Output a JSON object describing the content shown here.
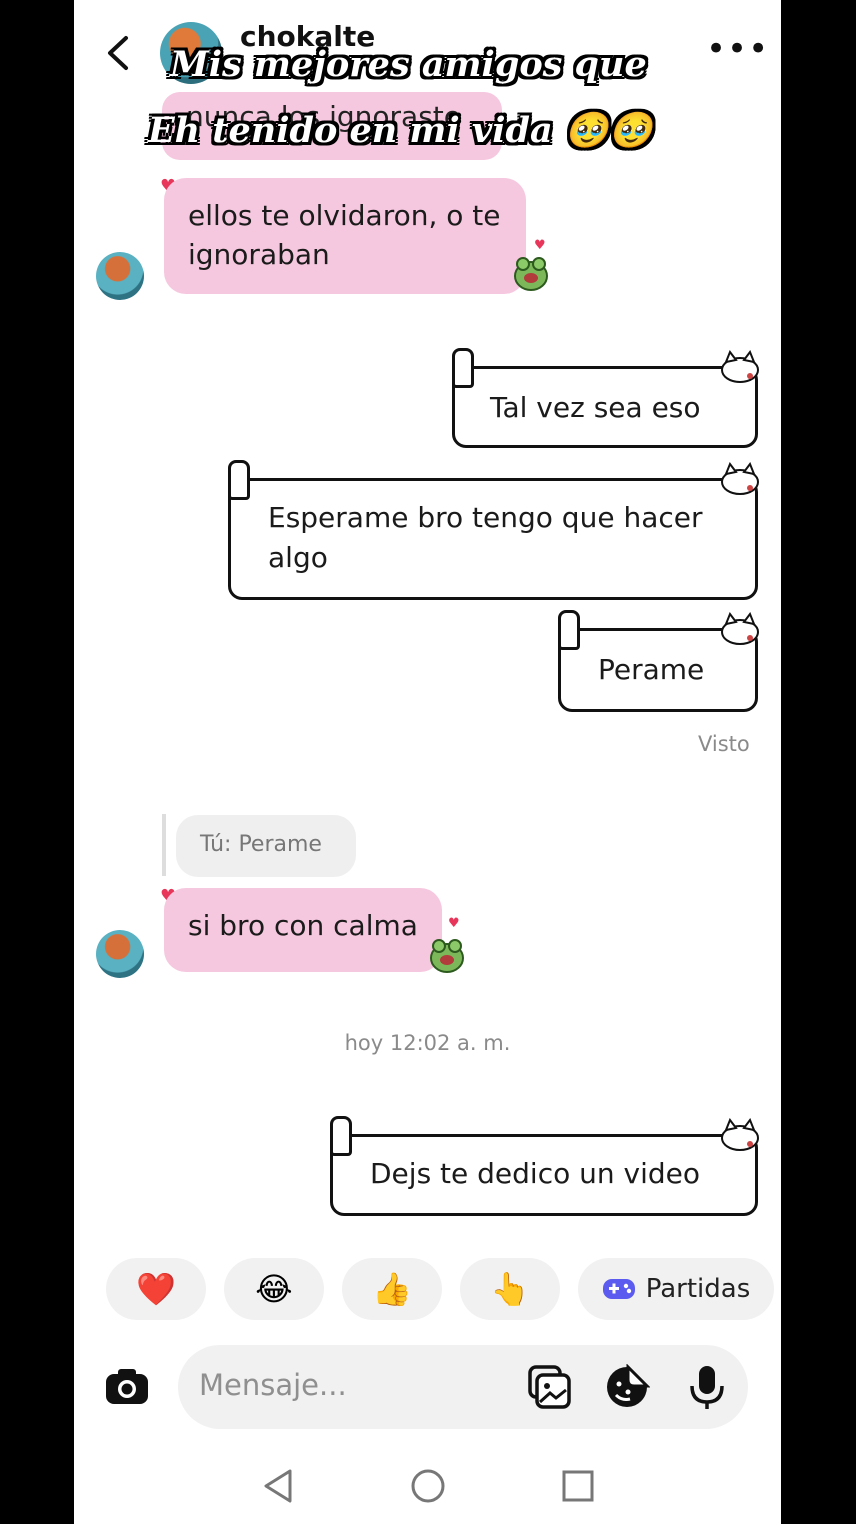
{
  "header": {
    "username": "chokalte",
    "more_label": "•••"
  },
  "overlay_caption": {
    "line1": "Mis mejores amigos que",
    "line2": "Eh tenido en mi vida 🥹🥹"
  },
  "messages": [
    {
      "id": "m0",
      "direction": "incoming",
      "text": "nunca los ignoraste",
      "partial": true
    },
    {
      "id": "m1",
      "direction": "incoming",
      "line1": "ellos te olvidaron, o te",
      "line2": "ignoraban"
    },
    {
      "id": "m2",
      "direction": "outgoing",
      "text": "Tal vez sea eso"
    },
    {
      "id": "m3",
      "direction": "outgoing",
      "line1": "Esperame bro tengo que hacer",
      "line2": "algo"
    },
    {
      "id": "m4",
      "direction": "outgoing",
      "text": "Perame",
      "status": "Visto"
    },
    {
      "id": "m5",
      "direction": "incoming",
      "reply_to": "Tú: Perame",
      "text": "si bro con calma"
    },
    {
      "id": "m6",
      "direction": "outgoing",
      "text": "Dejs te dedico un video"
    }
  ],
  "timestamp": "hoy 12:02 a. m.",
  "quick_reactions": [
    {
      "emoji": "❤️",
      "icon": "heart-icon"
    },
    {
      "emoji": "😂",
      "icon": "laughing-face-icon"
    },
    {
      "emoji": "👍",
      "icon": "thumbs-up-icon"
    },
    {
      "emoji": "👆",
      "icon": "pointing-up-icon"
    }
  ],
  "partidas": {
    "label": "Partidas",
    "icon": "gamepad-icon"
  },
  "composer": {
    "placeholder": "Mensaje..."
  },
  "colors": {
    "incoming_bubble": "#f6c8df",
    "accent": "#5b5bf0",
    "heart": "#e8365a"
  }
}
